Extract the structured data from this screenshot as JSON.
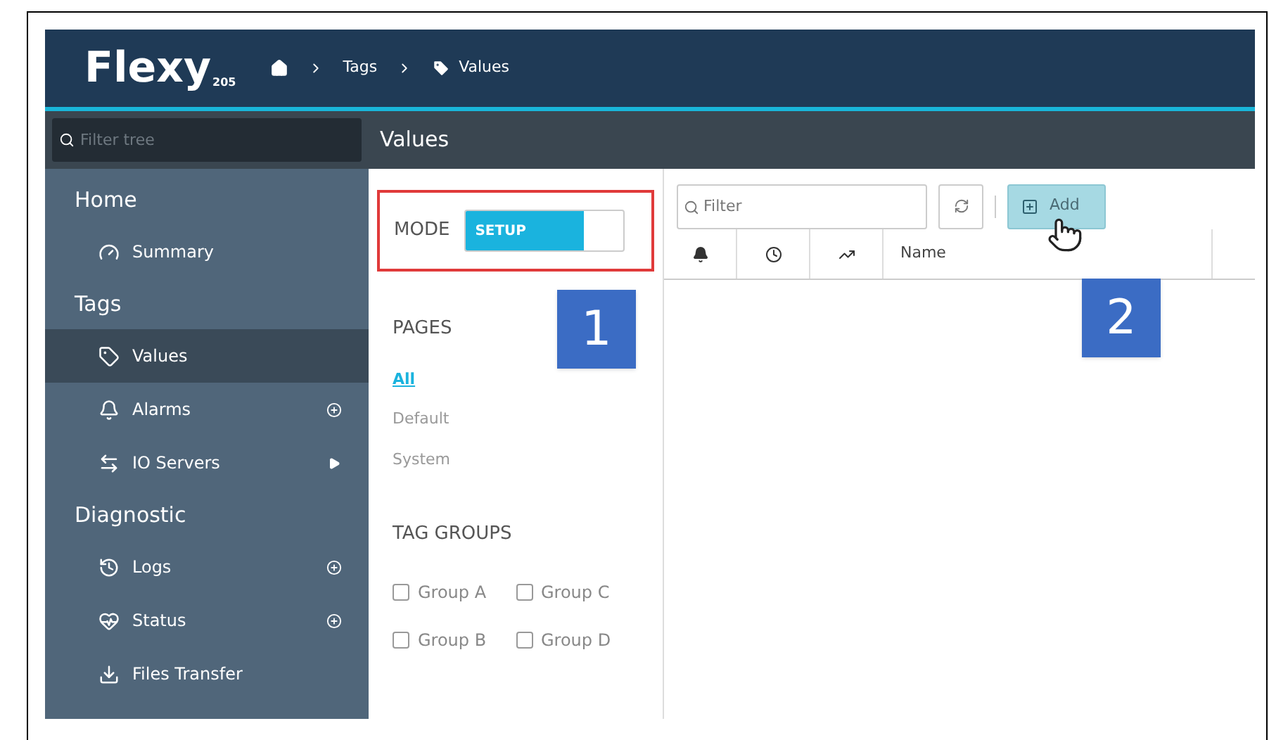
{
  "header": {
    "logo": "Flexy",
    "model": "205",
    "breadcrumb": [
      {
        "kind": "home"
      },
      {
        "kind": "text",
        "label": "Tags"
      },
      {
        "kind": "tag",
        "label": "Values"
      }
    ]
  },
  "filter_tree": {
    "placeholder": "Filter tree"
  },
  "page_title": "Values",
  "sidebar": [
    {
      "label": "Home",
      "children": [
        {
          "label": "Summary",
          "kind": "gauge",
          "selected": false,
          "add_button": false,
          "submenu": false
        }
      ]
    },
    {
      "label": "Tags",
      "children": [
        {
          "label": "Values",
          "kind": "tag",
          "selected": true,
          "add_button": false,
          "submenu": false
        },
        {
          "label": "Alarms",
          "kind": "bell",
          "selected": false,
          "add_button": true,
          "submenu": false
        },
        {
          "label": "IO Servers",
          "kind": "arrows",
          "selected": false,
          "add_button": false,
          "submenu": true
        }
      ]
    },
    {
      "label": "Diagnostic",
      "children": [
        {
          "label": "Logs",
          "kind": "history",
          "selected": false,
          "add_button": true,
          "submenu": false
        },
        {
          "label": "Status",
          "kind": "heart",
          "selected": false,
          "add_button": true,
          "submenu": false
        },
        {
          "label": "Files Transfer",
          "kind": "download",
          "selected": false,
          "add_button": false,
          "submenu": false
        }
      ]
    }
  ],
  "mode": {
    "label": "MODE",
    "value": "SETUP",
    "on": true,
    "highlighted": true
  },
  "pages": {
    "heading": "PAGES",
    "items": [
      {
        "label": "All",
        "selected": true
      },
      {
        "label": "Default",
        "selected": false
      },
      {
        "label": "System",
        "selected": false
      }
    ]
  },
  "tag_groups": {
    "heading": "TAG GROUPS",
    "items": [
      {
        "label": "Group A",
        "checked": false
      },
      {
        "label": "Group C",
        "checked": false
      },
      {
        "label": "Group B",
        "checked": false
      },
      {
        "label": "Group D",
        "checked": false
      }
    ]
  },
  "table": {
    "filter_placeholder": "Filter",
    "add_label": "Add",
    "columns": [
      {
        "kind": "bell"
      },
      {
        "kind": "clock"
      },
      {
        "kind": "chart"
      },
      {
        "kind": "text",
        "label": "Name"
      }
    ]
  },
  "callouts": [
    "1",
    "2"
  ]
}
